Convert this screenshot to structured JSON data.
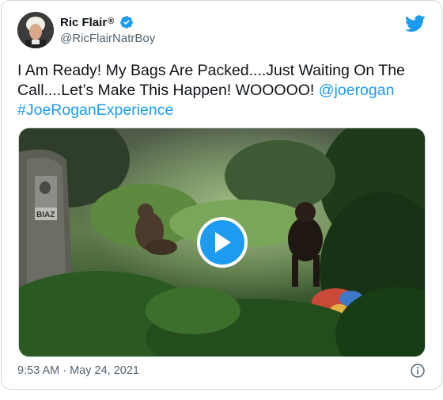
{
  "tweet": {
    "display_name": "Ric Flair",
    "registered_mark": "®",
    "handle": "@RicFlairNatrBoy",
    "text_plain": "I Am Ready! My Bags Are Packed....Just Waiting On The Call....Let’s Make This Happen! WOOOOO! ",
    "mention": "@joerogan",
    "hashtag": "#JoeRoganExperience",
    "timestamp": "9:53 AM · May 24, 2021"
  },
  "media": {
    "type": "video",
    "tree_sign_text": "BIAZ"
  },
  "icons": {
    "verified": "verified-badge-icon",
    "brand": "twitter-bird-icon",
    "play": "play-icon",
    "info": "info-icon"
  },
  "colors": {
    "accent": "#1d9bf0",
    "secondary_text": "#536471",
    "border": "#cfd9de"
  }
}
